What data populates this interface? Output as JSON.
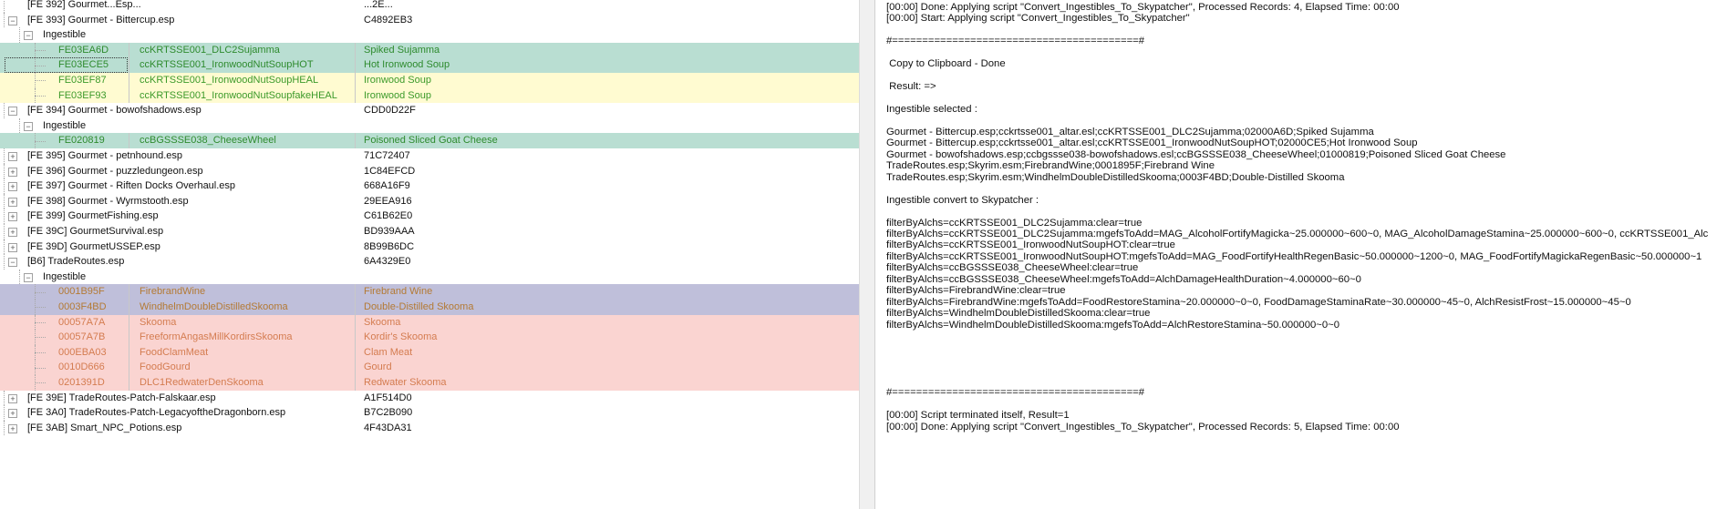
{
  "colors": {
    "green_bg": "#b9ded2",
    "green_text": "#2e8b2e",
    "yellow_bg": "#fffbd1",
    "purple_bg": "#bfbfda",
    "red_bg": "#fad4d1",
    "red_text": "#d47c50"
  },
  "tree": {
    "rows": [
      {
        "depth": 0,
        "exp": "",
        "style": "",
        "name": "[FE 392] Gourmet...Esp...",
        "id": "",
        "col3": "...2E..."
      },
      {
        "depth": 0,
        "exp": "-",
        "style": "",
        "name": "[FE 393] Gourmet - Bittercup.esp",
        "id": "",
        "col3": "C4892EB3"
      },
      {
        "depth": 1,
        "exp": "-",
        "style": "",
        "name": "Ingestible",
        "id": "",
        "col3": ""
      },
      {
        "depth": 2,
        "exp": "",
        "style": "green",
        "name": "FE03EA6D",
        "id": "ccKRTSSE001_DLC2Sujamma",
        "col3": "Spiked Sujamma"
      },
      {
        "depth": 2,
        "exp": "",
        "style": "green",
        "name": "FE03ECE5",
        "id": "ccKRTSSE001_IronwoodNutSoupHOT",
        "col3": "Hot Ironwood Soup",
        "selected": true
      },
      {
        "depth": 2,
        "exp": "",
        "style": "yellow",
        "name": "FE03EF87",
        "id": "ccKRTSSE001_IronwoodNutSoupHEAL",
        "col3": "Ironwood Soup"
      },
      {
        "depth": 2,
        "exp": "",
        "style": "yellow",
        "name": "FE03EF93",
        "id": "ccKRTSSE001_IronwoodNutSoupfakeHEAL",
        "col3": "Ironwood Soup"
      },
      {
        "depth": 0,
        "exp": "-",
        "style": "",
        "name": "[FE 394] Gourmet - bowofshadows.esp",
        "id": "",
        "col3": "CDD0D22F"
      },
      {
        "depth": 1,
        "exp": "-",
        "style": "",
        "name": "Ingestible",
        "id": "",
        "col3": ""
      },
      {
        "depth": 2,
        "exp": "",
        "style": "green",
        "name": "FE020819",
        "id": "ccBGSSSE038_CheeseWheel",
        "col3": "Poisoned Sliced Goat Cheese"
      },
      {
        "depth": 0,
        "exp": "+",
        "style": "",
        "name": "[FE 395] Gourmet - petnhound.esp",
        "id": "",
        "col3": "71C72407"
      },
      {
        "depth": 0,
        "exp": "+",
        "style": "",
        "name": "[FE 396] Gourmet - puzzledungeon.esp",
        "id": "",
        "col3": "1C84EFCD"
      },
      {
        "depth": 0,
        "exp": "+",
        "style": "",
        "name": "[FE 397] Gourmet - Riften Docks Overhaul.esp",
        "id": "",
        "col3": "668A16F9"
      },
      {
        "depth": 0,
        "exp": "+",
        "style": "",
        "name": "[FE 398] Gourmet - Wyrmstooth.esp",
        "id": "",
        "col3": "29EEA916"
      },
      {
        "depth": 0,
        "exp": "+",
        "style": "",
        "name": "[FE 399] GourmetFishing.esp",
        "id": "",
        "col3": "C61B62E0"
      },
      {
        "depth": 0,
        "exp": "+",
        "style": "",
        "name": "[FE 39C] GourmetSurvival.esp",
        "id": "",
        "col3": "BD939AAA"
      },
      {
        "depth": 0,
        "exp": "+",
        "style": "",
        "name": "[FE 39D] GourmetUSSEP.esp",
        "id": "",
        "col3": "8B99B6DC"
      },
      {
        "depth": 0,
        "exp": "-",
        "style": "",
        "name": "[B6] TradeRoutes.esp",
        "id": "",
        "col3": "6A4329E0"
      },
      {
        "depth": 1,
        "exp": "-",
        "style": "",
        "name": "Ingestible",
        "id": "",
        "col3": ""
      },
      {
        "depth": 2,
        "exp": "",
        "style": "purple",
        "name": "0001B95F",
        "id": "FirebrandWine",
        "col3": "Firebrand Wine"
      },
      {
        "depth": 2,
        "exp": "",
        "style": "purple",
        "name": "0003F4BD",
        "id": "WindhelmDoubleDistilledSkooma",
        "col3": "Double-Distilled Skooma"
      },
      {
        "depth": 2,
        "exp": "",
        "style": "red",
        "name": "00057A7A",
        "id": "Skooma",
        "col3": "Skooma"
      },
      {
        "depth": 2,
        "exp": "",
        "style": "red",
        "name": "00057A7B",
        "id": "FreeformAngasMillKordirsSkooma",
        "col3": "Kordir's Skooma"
      },
      {
        "depth": 2,
        "exp": "",
        "style": "red",
        "name": "000EBA03",
        "id": "FoodClamMeat",
        "col3": "Clam Meat"
      },
      {
        "depth": 2,
        "exp": "",
        "style": "red",
        "name": "0010D666",
        "id": "FoodGourd",
        "col3": "Gourd"
      },
      {
        "depth": 2,
        "exp": "",
        "style": "red",
        "name": "0201391D",
        "id": "DLC1RedwaterDenSkooma",
        "col3": "Redwater Skooma"
      },
      {
        "depth": 0,
        "exp": "+",
        "style": "",
        "name": "[FE 39E] TradeRoutes-Patch-Falskaar.esp",
        "id": "",
        "col3": "A1F514D0"
      },
      {
        "depth": 0,
        "exp": "+",
        "style": "",
        "name": "[FE 3A0] TradeRoutes-Patch-LegacyoftheDragonborn.esp",
        "id": "",
        "col3": "B7C2B090"
      },
      {
        "depth": 0,
        "exp": "+",
        "style": "",
        "name": "[FE 3AB] Smart_NPC_Potions.esp",
        "id": "",
        "col3": "4F43DA31"
      }
    ]
  },
  "log": {
    "lines": [
      "[00:00] Done: Applying script \"Convert_Ingestibles_To_Skypatcher\", Processed Records: 4, Elapsed Time: 00:00",
      "[00:00] Start: Applying script \"Convert_Ingestibles_To_Skypatcher\"",
      "",
      "#=========================================#",
      "",
      " Copy to Clipboard - Done",
      "",
      " Result: =>",
      "",
      "Ingestible selected :",
      "",
      "Gourmet - Bittercup.esp;cckrtsse001_altar.esl;ccKRTSSE001_DLC2Sujamma;02000A6D;Spiked Sujamma",
      "Gourmet - Bittercup.esp;cckrtsse001_altar.esl;ccKRTSSE001_IronwoodNutSoupHOT;02000CE5;Hot Ironwood Soup",
      "Gourmet - bowofshadows.esp;ccbgssse038-bowofshadows.esl;ccBGSSSE038_CheeseWheel;01000819;Poisoned Sliced Goat Cheese",
      "TradeRoutes.esp;Skyrim.esm;FirebrandWine;0001895F;Firebrand Wine",
      "TradeRoutes.esp;Skyrim.esm;WindhelmDoubleDistilledSkooma;0003F4BD;Double-Distilled Skooma",
      "",
      "Ingestible convert to Skypatcher :",
      "",
      "filterByAlchs=ccKRTSSE001_DLC2Sujamma:clear=true",
      "filterByAlchs=ccKRTSSE001_DLC2Sujamma:mgefsToAdd=MAG_AlcoholFortifyMagicka~25.000000~600~0, MAG_AlcoholDamageStamina~25.000000~600~0, ccKRTSSE001_Alc",
      "filterByAlchs=ccKRTSSE001_IronwoodNutSoupHOT:clear=true",
      "filterByAlchs=ccKRTSSE001_IronwoodNutSoupHOT:mgefsToAdd=MAG_FoodFortifyHealthRegenBasic~50.000000~1200~0, MAG_FoodFortifyMagickaRegenBasic~50.000000~1",
      "filterByAlchs=ccBGSSSE038_CheeseWheel:clear=true",
      "filterByAlchs=ccBGSSSE038_CheeseWheel:mgefsToAdd=AlchDamageHealthDuration~4.000000~60~0",
      "filterByAlchs=FirebrandWine:clear=true",
      "filterByAlchs=FirebrandWine:mgefsToAdd=FoodRestoreStamina~20.000000~0~0, FoodDamageStaminaRate~30.000000~45~0, AlchResistFrost~15.000000~45~0",
      "filterByAlchs=WindhelmDoubleDistilledSkooma:clear=true",
      "filterByAlchs=WindhelmDoubleDistilledSkooma:mgefsToAdd=AlchRestoreStamina~50.000000~0~0",
      "",
      "",
      "",
      "",
      "",
      "#=========================================#",
      "",
      "[00:00] Script terminated itself, Result=1",
      "[00:00] Done: Applying script \"Convert_Ingestibles_To_Skypatcher\", Processed Records: 5, Elapsed Time: 00:00"
    ]
  }
}
